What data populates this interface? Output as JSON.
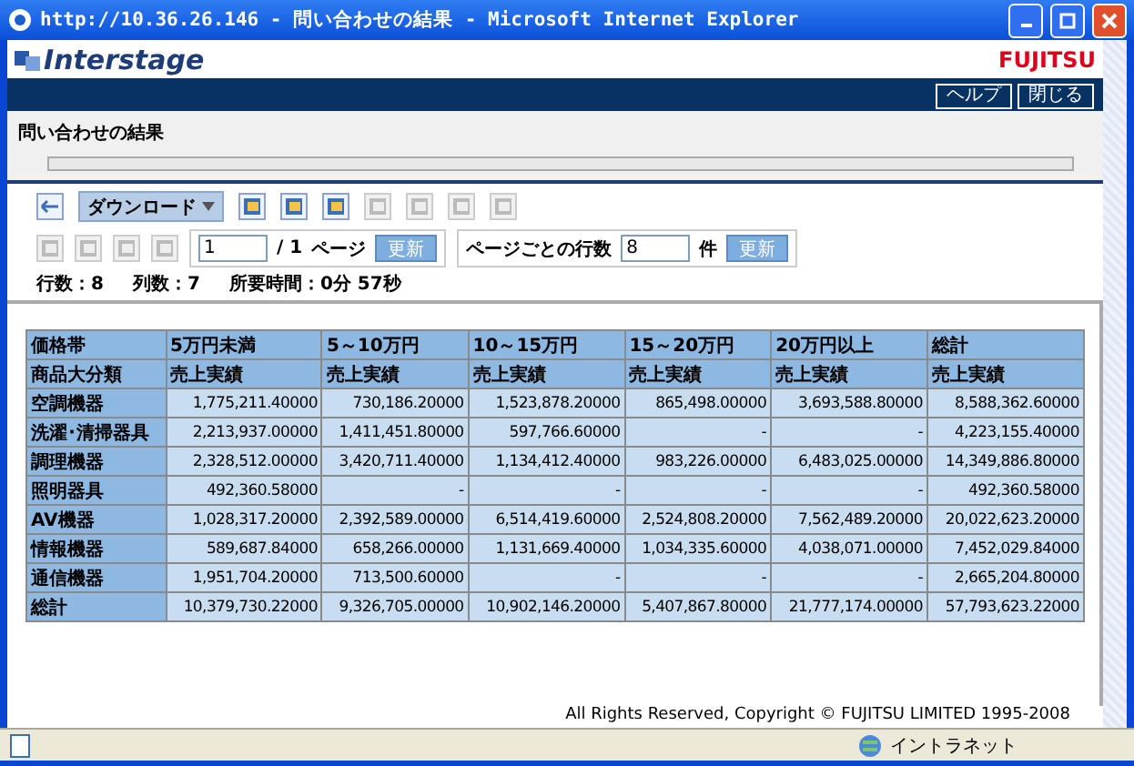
{
  "window": {
    "title": "http://10.36.26.146 - 問い合わせの結果 - Microsoft Internet Explorer"
  },
  "header": {
    "logo": "Interstage",
    "brand": "FUJITSU",
    "nav_buttons": [
      "ヘルプ",
      "閉じる"
    ]
  },
  "page_title": "問い合わせの結果",
  "progress": {
    "level": 0
  },
  "toolbar": {
    "download": "ダウンロード",
    "tools": [
      {
        "disabled": false
      },
      {
        "disabled": false
      },
      {
        "disabled": false
      },
      {
        "disabled": true
      },
      {
        "disabled": true
      },
      {
        "disabled": true
      },
      {
        "disabled": true
      }
    ]
  },
  "pager": {
    "nav": [
      {
        "disabled": true
      },
      {
        "disabled": true
      },
      {
        "disabled": true
      },
      {
        "disabled": true
      }
    ],
    "page": "1",
    "total": "/ 1",
    "page_label": "ページ",
    "refresh": "更新",
    "rows_label": "ページごとの行数",
    "rows_value": "8",
    "rows_unit": "件",
    "rows_refresh": "更新"
  },
  "stats": [
    "行数：8",
    "列数：7",
    "所要時間：0分 57秒"
  ],
  "table": {
    "header_rows": [
      [
        "価格帯",
        "5万円未満",
        "5～10万円",
        "10～15万円",
        "15～20万円",
        "20万円以上",
        "総計"
      ],
      [
        "商品大分類",
        "売上実績",
        "売上実績",
        "売上実績",
        "売上実績",
        "売上実績",
        "売上実績"
      ]
    ],
    "rows": [
      [
        "空調機器",
        "1,775,211.40000",
        "730,186.20000",
        "1,523,878.20000",
        "865,498.00000",
        "3,693,588.80000",
        "8,588,362.60000"
      ],
      [
        "洗濯･清掃器具",
        "2,213,937.00000",
        "1,411,451.80000",
        "597,766.60000",
        "-",
        "-",
        "4,223,155.40000"
      ],
      [
        "調理機器",
        "2,328,512.00000",
        "3,420,711.40000",
        "1,134,412.40000",
        "983,226.00000",
        "6,483,025.00000",
        "14,349,886.80000"
      ],
      [
        "照明器具",
        "492,360.58000",
        "-",
        "-",
        "-",
        "-",
        "492,360.58000"
      ],
      [
        "AV機器",
        "1,028,317.20000",
        "2,392,589.00000",
        "6,514,419.60000",
        "2,524,808.20000",
        "7,562,489.20000",
        "20,022,623.20000"
      ],
      [
        "情報機器",
        "589,687.84000",
        "658,266.00000",
        "1,131,669.40000",
        "1,034,335.60000",
        "4,038,071.00000",
        "7,452,029.84000"
      ],
      [
        "通信機器",
        "1,951,704.20000",
        "713,500.60000",
        "-",
        "-",
        "-",
        "2,665,204.80000"
      ],
      [
        "総計",
        "10,379,730.22000",
        "9,326,705.00000",
        "10,902,146.20000",
        "5,407,867.80000",
        "21,777,174.00000",
        "57,793,623.22000"
      ]
    ]
  },
  "copyright": "All Rights Reserved, Copyright © FUJITSU LIMITED 1995-2008",
  "status_bar": {
    "zone": "イントラネット"
  }
}
